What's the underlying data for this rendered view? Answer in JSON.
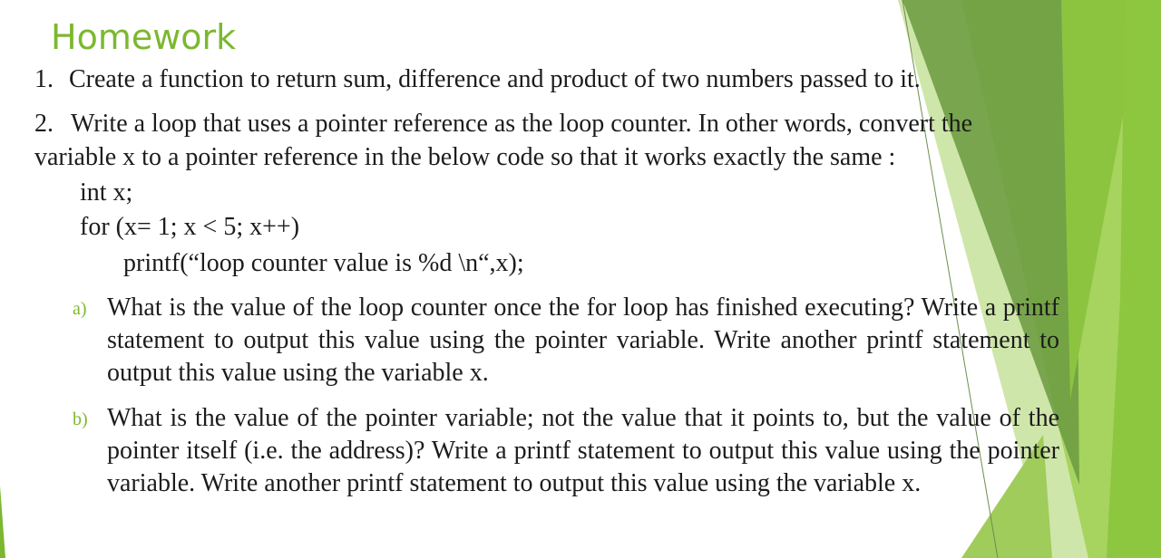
{
  "title": "Homework",
  "items": [
    {
      "number": "1.",
      "text": "Create a function to return sum, difference and product of two numbers passed to it."
    },
    {
      "number": "2.",
      "text_line1": "Write a loop that uses a pointer reference as the loop counter. In other words, convert the",
      "text_line2": "variable x to a pointer reference in the below code so that it works exactly the same :",
      "code": [
        "int x;",
        "for (x= 1; x < 5; x++)",
        "printf(“loop counter value is %d \\n“,x);"
      ]
    }
  ],
  "subitems": [
    {
      "marker": "a)",
      "text": "What is the value of the loop counter once the for loop has finished executing? Write a printf statement to output this value using the pointer variable. Write another printf statement to output this value using the variable x."
    },
    {
      "marker": "b)",
      "text": "What is the value of the pointer variable; not the value that it points to, but the value of the pointer itself (i.e. the address)? Write a printf statement to output this value using the pointer variable. Write another printf statement to output this value using the variable x."
    }
  ],
  "colors": {
    "accent": "#7cb82f",
    "text": "#1c1c1c"
  }
}
